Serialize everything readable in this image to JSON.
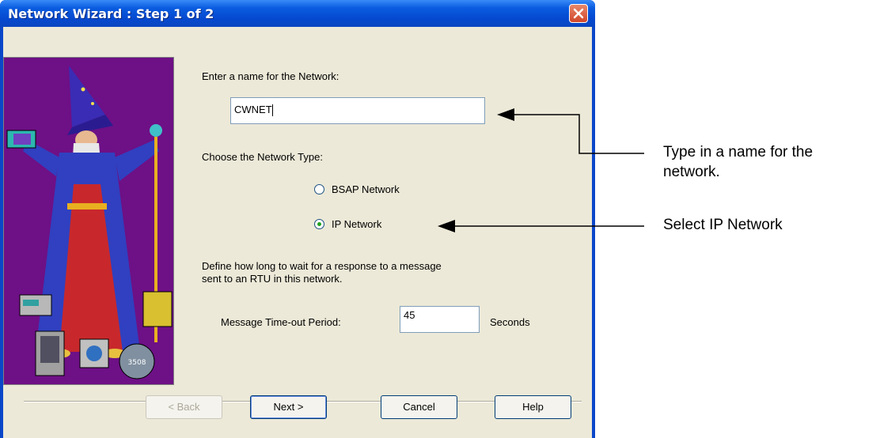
{
  "dialog": {
    "title": "Network Wizard : Step 1 of 2",
    "network_name_label": "Enter a name for the Network:",
    "network_name_value": "CWNET",
    "network_type_label": "Choose the Network Type:",
    "network_types": [
      {
        "label": "BSAP Network",
        "selected": false
      },
      {
        "label": "IP Network",
        "selected": true
      }
    ],
    "timeout_description_line1": "Define how long to wait for a response to a message",
    "timeout_description_line2": "sent to an RTU in this network.",
    "timeout_label": "Message Time-out Period:",
    "timeout_value": "45",
    "timeout_unit": "Seconds",
    "buttons": {
      "back": "< Back",
      "next": "Next >",
      "cancel": "Cancel",
      "help": "Help"
    },
    "panel_badge": "3508"
  },
  "annotations": {
    "name_line1": "Type in a name for the",
    "name_line2": "network.",
    "ip_select": "Select IP Network"
  },
  "colors": {
    "titlebar": "#0A5CE0",
    "client": "#ECE9D8",
    "wizard_panel": "#6E1086"
  }
}
